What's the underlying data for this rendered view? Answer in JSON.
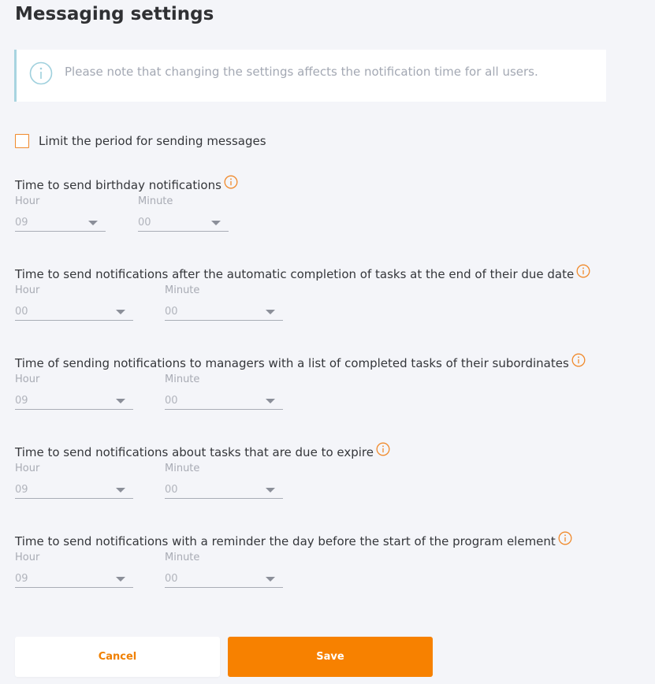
{
  "page": {
    "title": "Messaging settings"
  },
  "notice": {
    "text": "Please note that changing the settings affects the notification time for all users."
  },
  "limit_period": {
    "label": "Limit the period for sending messages",
    "checked": false
  },
  "field_labels": {
    "hour": "Hour",
    "minute": "Minute"
  },
  "sections": [
    {
      "title": "Time to send birthday notifications",
      "hour": "09",
      "minute": "00"
    },
    {
      "title": "Time to send notifications after the automatic completion of tasks at the end of their due date",
      "hour": "00",
      "minute": "00"
    },
    {
      "title": "Time of sending notifications to managers with a list of completed tasks of their subordinates",
      "hour": "09",
      "minute": "00"
    },
    {
      "title": "Time to send notifications about tasks that are due to expire",
      "hour": "09",
      "minute": "00"
    },
    {
      "title": "Time to send notifications with a reminder the day before the start of the program element",
      "hour": "09",
      "minute": "00"
    }
  ],
  "buttons": {
    "cancel": "Cancel",
    "save": "Save"
  },
  "colors": {
    "accent": "#f78100",
    "info_blue": "#a8d4e0",
    "background": "#f4f5f9"
  }
}
